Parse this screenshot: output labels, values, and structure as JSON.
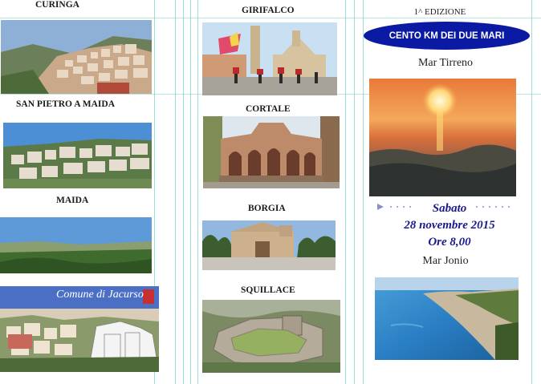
{
  "brochure": {
    "edition": "1^ EDIZIONE",
    "event_title": "CENTO KM DEI DUE MARI",
    "sea_top": "Mar Tirreno",
    "day": "Sabato",
    "date": "28 novembre 2015",
    "time": "Ore  8,00",
    "sea_bottom": "Mar Jonio"
  },
  "towns": {
    "curinga": "CURINGA",
    "san_pietro": "SAN PIETRO A MAIDA",
    "maida": "MAIDA",
    "jacurso_banner": "Comune di Jacurso",
    "girifalco": "GIRIFALCO",
    "cortale": "CORTALE",
    "borgia": "BORGIA",
    "squillace": "SQUILLACE"
  },
  "colors": {
    "accent": "#0a1aa3",
    "date_text": "#1a1a8c",
    "guides": "#7ed3cf"
  },
  "icons": {
    "bullet": "triangle-bullet-icon"
  }
}
